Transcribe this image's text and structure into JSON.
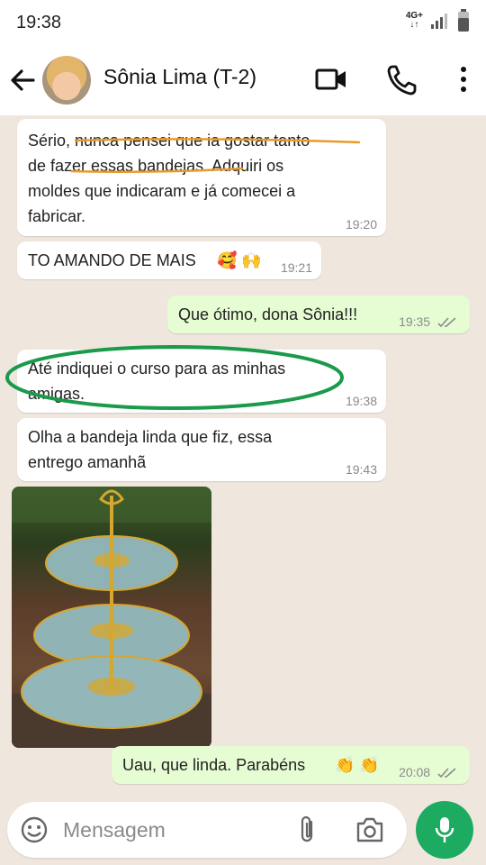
{
  "status": {
    "time": "19:38",
    "network_label_top": "4G+",
    "network_label_bottom": "↓↑"
  },
  "header": {
    "contact_name": "Sônia Lima (T-2)"
  },
  "messages": [
    {
      "dir": "in",
      "lines": [
        "Sério, nunca pensei que ia gostar tanto",
        "de fazer essas bandejas. Adquiri os",
        "moldes que indicaram e já comecei a",
        "fabricar."
      ],
      "time": "19:20"
    },
    {
      "dir": "in",
      "text": "TO AMANDO DE MAIS",
      "emoji": "🥰 🙌",
      "time": "19:21"
    },
    {
      "dir": "out",
      "text": "Que ótimo, dona Sônia!!!",
      "time": "19:35"
    },
    {
      "dir": "in",
      "lines": [
        "Até indiquei o curso para as minhas",
        "amigas."
      ],
      "time": "19:38"
    },
    {
      "dir": "in",
      "lines": [
        "Olha a bandeja linda que fiz, essa",
        "entrego amanhã"
      ],
      "time": "19:43"
    },
    {
      "dir": "out",
      "text": "Uau, que linda. Parabéns",
      "emoji": "👏 👏",
      "time": "20:08"
    }
  ],
  "composer": {
    "placeholder": "Mensagem"
  },
  "colors": {
    "incoming": "#ffffff",
    "outgoing": "#e6fdd3",
    "accent": "#1daa61",
    "annotation_underline": "#e89a2b",
    "annotation_circle": "#1a9a4a"
  },
  "icons": [
    "back-arrow-icon",
    "video-call-icon",
    "phone-icon",
    "more-vert-icon",
    "emoji-icon",
    "attach-icon",
    "camera-icon",
    "mic-icon",
    "double-check-icon"
  ]
}
